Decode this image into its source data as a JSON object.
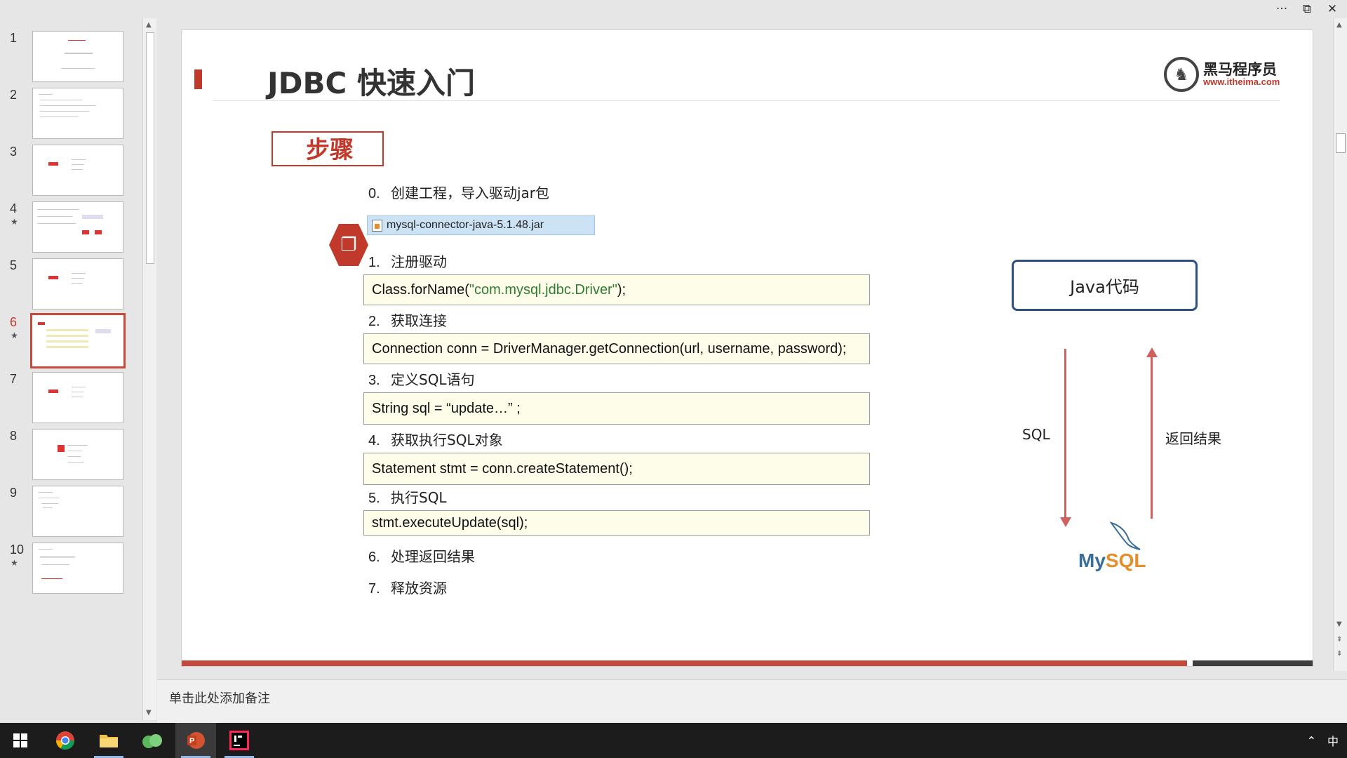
{
  "window": {
    "more": "···",
    "restore": "⧉",
    "close": "✕"
  },
  "thumbnails": [
    {
      "num": "1",
      "star": ""
    },
    {
      "num": "2",
      "star": ""
    },
    {
      "num": "3",
      "star": ""
    },
    {
      "num": "4",
      "star": "★"
    },
    {
      "num": "5",
      "star": ""
    },
    {
      "num": "6",
      "star": "★"
    },
    {
      "num": "7",
      "star": ""
    },
    {
      "num": "8",
      "star": ""
    },
    {
      "num": "9",
      "star": ""
    },
    {
      "num": "10",
      "star": "★"
    }
  ],
  "slide": {
    "title": "JDBC 快速入门",
    "logo_cn": "黑马程序员",
    "logo_url": "www.itheima.com",
    "step_label": "步骤",
    "steps": [
      {
        "num": "0.",
        "text": "创建工程，导入驱动jar包"
      },
      {
        "num": "1.",
        "text": "注册驱动"
      },
      {
        "num": "2.",
        "text": "获取连接"
      },
      {
        "num": "3.",
        "text": "定义SQL语句"
      },
      {
        "num": "4.",
        "text": "获取执行SQL对象"
      },
      {
        "num": "5.",
        "text": "执行SQL"
      },
      {
        "num": "6.",
        "text": "处理返回结果"
      },
      {
        "num": "7.",
        "text": "释放资源"
      }
    ],
    "jar_file": "mysql-connector-java-5.1.48.jar",
    "code": {
      "register_prefix": "Class.forName(",
      "register_string": "\"com.mysql.jdbc.Driver\"",
      "register_suffix": ");",
      "connection": "Connection conn = DriverManager.getConnection(url, username, password);",
      "sql": "String sql =  “update…” ;",
      "statement": "Statement stmt = conn.createStatement();",
      "execute": "stmt.executeUpdate(sql);"
    },
    "java_box": "Java代码",
    "sql_label": "SQL",
    "return_label": "返回结果",
    "mysql_my": "My",
    "mysql_sql": "SQL"
  },
  "notes": {
    "placeholder": "单击此处添加备注"
  },
  "taskbar": {
    "ime": "中",
    "tray_arrow": "⌃"
  },
  "colors": {
    "accent_red": "#c0392b",
    "java_border": "#2f4f7f",
    "code_bg": "#fefdea"
  }
}
